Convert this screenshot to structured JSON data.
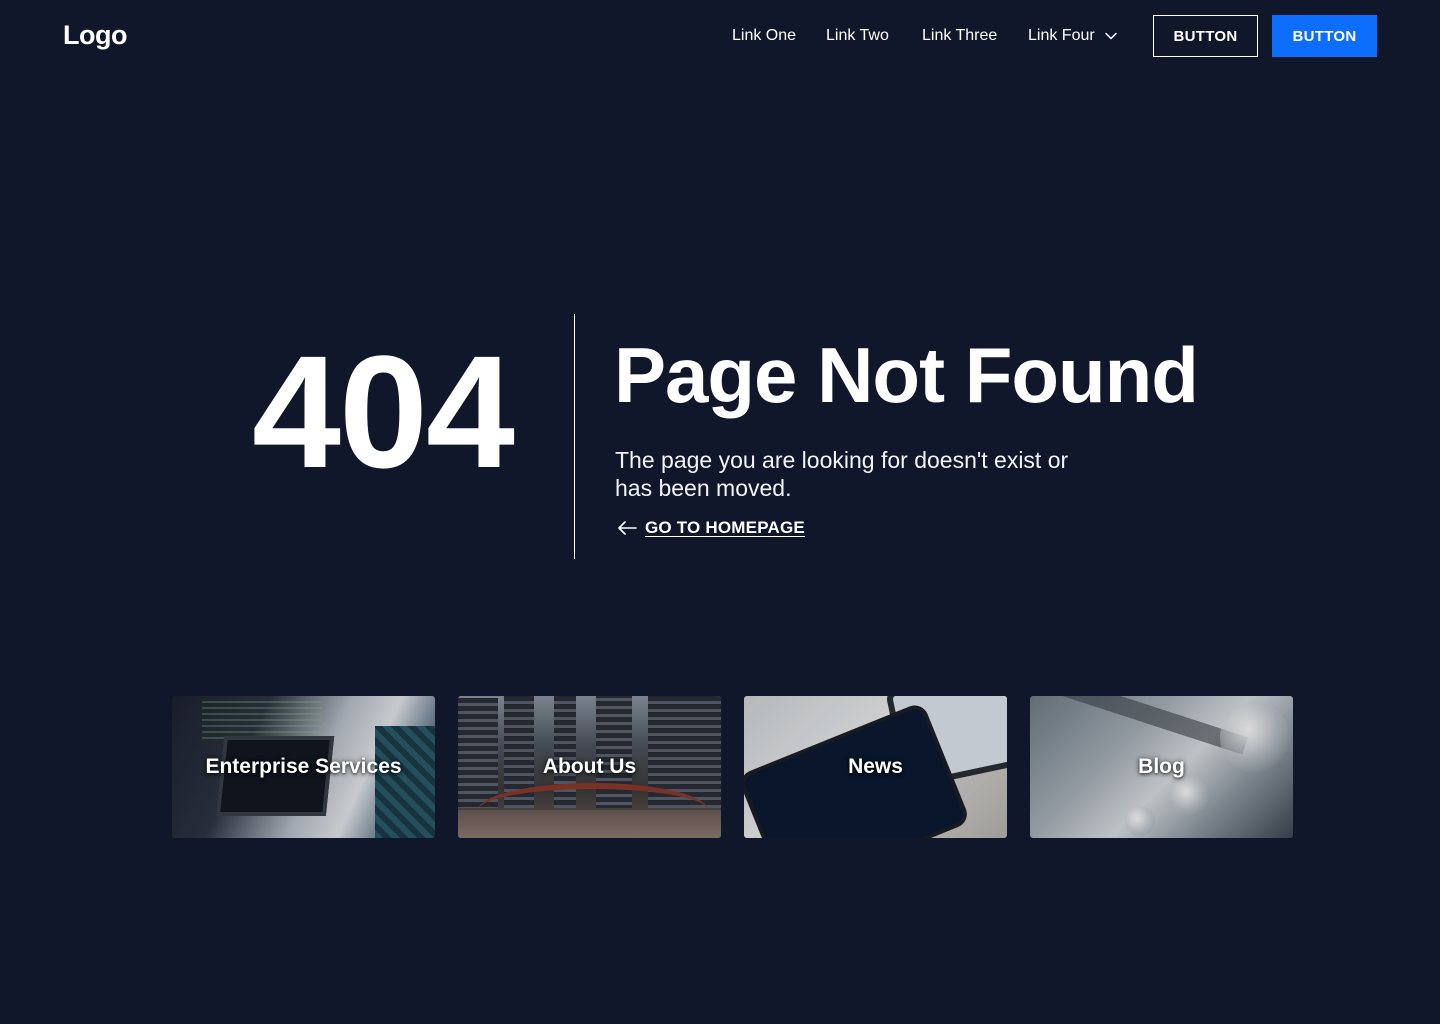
{
  "header": {
    "logo": "Logo",
    "links": [
      "Link One",
      "Link Two",
      "Link Three"
    ],
    "dropdown_label": "Link Four",
    "button_secondary": "BUTTON",
    "button_primary": "BUTTON"
  },
  "hero": {
    "code": "404",
    "title": "Page Not Found",
    "message": "The page you are looking for doesn't exist or has been moved.",
    "home_link": "GO TO HOMEPAGE"
  },
  "cards": [
    {
      "label": "Enterprise Services"
    },
    {
      "label": "About Us"
    },
    {
      "label": "News"
    },
    {
      "label": "Blog"
    }
  ],
  "colors": {
    "background": "#11172b",
    "primary": "#0d6efd",
    "text": "#ffffff"
  }
}
